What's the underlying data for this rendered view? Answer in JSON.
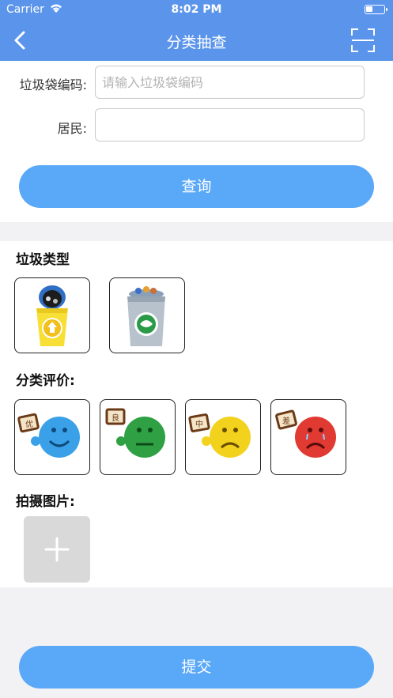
{
  "status_bar": {
    "carrier": "Carrier",
    "time": "8:02 PM"
  },
  "nav": {
    "title": "分类抽查",
    "back_icon": "chevron-left-icon",
    "scan_icon": "scan-icon"
  },
  "form": {
    "bag_code_label": "垃圾袋编码:",
    "bag_code_placeholder": "请输入垃圾袋编码",
    "bag_code_value": "",
    "resident_label": "居民:",
    "resident_value": "",
    "query_button": "查询"
  },
  "garbage_type": {
    "title": "垃圾类型",
    "options": [
      {
        "name": "recyclable-bin",
        "icon": "recycle-bin-icon"
      },
      {
        "name": "kitchen-waste-bin",
        "icon": "kitchen-bin-icon"
      }
    ]
  },
  "evaluation": {
    "title": "分类评价:",
    "options": [
      {
        "label": "优",
        "color": "#3aa0e8"
      },
      {
        "label": "良",
        "color": "#2fa043"
      },
      {
        "label": "中",
        "color": "#f3d21e"
      },
      {
        "label": "差",
        "color": "#e03a32"
      }
    ]
  },
  "photo": {
    "title": "拍摄图片:",
    "add_icon": "plus-icon"
  },
  "submit_button": "提交",
  "colors": {
    "primary": "#5b95eb",
    "button": "#5aa8f8"
  }
}
